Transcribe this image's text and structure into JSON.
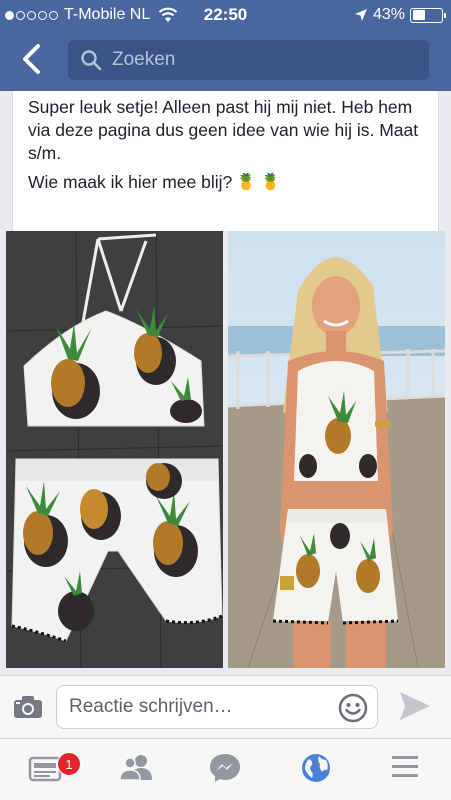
{
  "status_bar": {
    "carrier": "T-Mobile NL",
    "time": "22:50",
    "battery_percent": "43%",
    "battery_level": 0.43,
    "signal_bars_filled": 1,
    "signal_bars_total": 5
  },
  "header": {
    "back_icon": "chevron-left-icon",
    "search_placeholder": "Zoeken",
    "background": "#4a669e"
  },
  "post": {
    "line1": "Super leuk setje! Alleen past hij mij niet. Heb hem via deze pagina dus geen idee van wie hij is. Maat s/m.",
    "line2": "Wie maak ik hier mee blij?",
    "emoji": "🍍 🍍"
  },
  "photos": [
    {
      "description_icon": "flatlay-photo"
    },
    {
      "description_icon": "model-photo"
    }
  ],
  "composer": {
    "placeholder": "Reactie schrijven…",
    "camera_icon": "camera-icon",
    "emoji_icon": "smiley-icon",
    "send_icon": "send-icon"
  },
  "tab_bar": {
    "tabs": [
      "news-feed-icon",
      "friends-icon",
      "messenger-icon",
      "globe-icon",
      "menu-icon"
    ],
    "badge_count": "1",
    "active_color": "#4a80d8",
    "inactive_color": "#9297a0"
  }
}
